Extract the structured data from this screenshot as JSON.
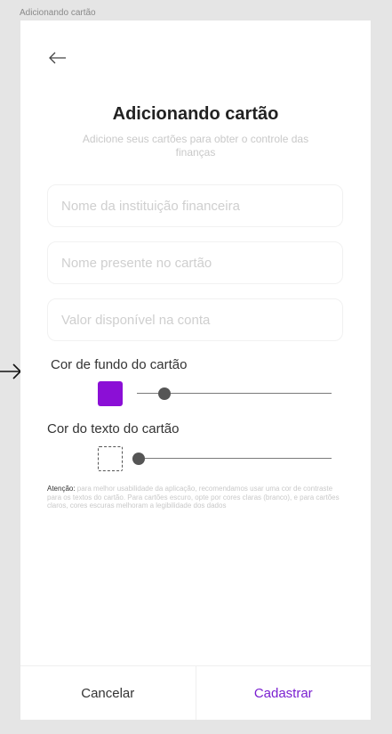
{
  "frame_label": "Adicionando cartão",
  "header": {
    "title": "Adicionando cartão",
    "subtitle": "Adicione seus cartões para obter o controle das finanças"
  },
  "form": {
    "institution_placeholder": "Nome da instituição financeira",
    "card_name_placeholder": "Nome presente no cartão",
    "balance_placeholder": "Valor disponível na conta"
  },
  "background_color": {
    "label": "Cor de fundo do cartão",
    "color": "#8b0fd6",
    "slider_value": 0.14
  },
  "text_color": {
    "label": "Cor do texto do cartão",
    "color": "#ffffff",
    "slider_value": 0.0
  },
  "note": {
    "prefix": "Atenção:",
    "text": " para melhor usabilidade da aplicação, recomendamos usar uma cor de contraste para os textos do cartão. Para cartões escuro, opte por cores claras (branco), e para cartões claros, cores escuras melhoram a legibilidade dos dados"
  },
  "footer": {
    "cancel_label": "Cancelar",
    "submit_label": "Cadastrar"
  },
  "colors": {
    "accent": "#7a1fd0"
  }
}
